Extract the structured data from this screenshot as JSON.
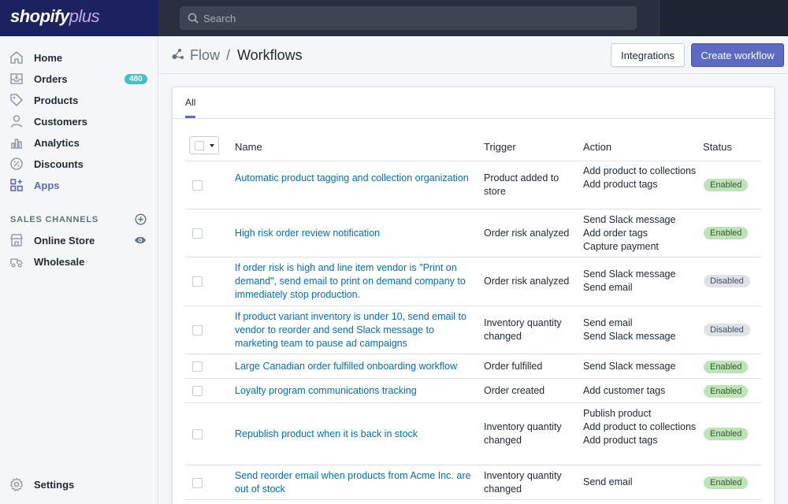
{
  "brand": {
    "name": "shopify",
    "suffix": "plus"
  },
  "search": {
    "placeholder": "Search"
  },
  "sidebar": {
    "items": [
      {
        "label": "Home",
        "icon": "home-icon"
      },
      {
        "label": "Orders",
        "icon": "orders-icon",
        "badge": "480"
      },
      {
        "label": "Products",
        "icon": "tag-icon"
      },
      {
        "label": "Customers",
        "icon": "person-icon"
      },
      {
        "label": "Analytics",
        "icon": "bar-chart-icon"
      },
      {
        "label": "Discounts",
        "icon": "discount-icon"
      },
      {
        "label": "Apps",
        "icon": "apps-icon",
        "active": true
      }
    ],
    "sales_channels_header": "SALES CHANNELS",
    "channels": [
      {
        "label": "Online Store",
        "icon": "store-icon"
      },
      {
        "label": "Wholesale",
        "icon": "wholesale-icon"
      }
    ],
    "settings": {
      "label": "Settings",
      "icon": "gear-icon"
    }
  },
  "header": {
    "breadcrumb_app": "Flow",
    "separator": "/",
    "title": "Workflows",
    "integrations_label": "Integrations",
    "create_label": "Create workflow"
  },
  "tabs": {
    "all": "All"
  },
  "table": {
    "columns": [
      "Name",
      "Trigger",
      "Action",
      "Status"
    ],
    "rows": [
      {
        "name": "Automatic product tagging and collection organization",
        "trigger": "Product added to store",
        "actions": [
          "Add product to collections",
          "Add product tags"
        ],
        "status": "Enabled"
      },
      {
        "name": "High risk order review notification",
        "trigger": "Order risk analyzed",
        "actions": [
          "Send Slack message",
          "Add order tags",
          "Capture payment"
        ],
        "status": "Enabled"
      },
      {
        "name": "If order risk is high and line item vendor is \"Print on demand\", send email to print on demand company to immediately stop production.",
        "trigger": "Order risk analyzed",
        "actions": [
          "Send Slack message",
          "Send email"
        ],
        "status": "Disabled"
      },
      {
        "name": "If product variant inventory is under 10, send email to vendor to reorder and send Slack message to marketing team to pause ad campaigns",
        "trigger": "Inventory quantity changed",
        "actions": [
          "Send email",
          "Send Slack message"
        ],
        "status": "Disabled"
      },
      {
        "name": "Large Canadian order fulfilled onboarding workflow",
        "trigger": "Order fulfilled",
        "actions": [
          "Send Slack message"
        ],
        "status": "Enabled"
      },
      {
        "name": "Loyalty program communications tracking",
        "trigger": "Order created",
        "actions": [
          "Add customer tags"
        ],
        "status": "Enabled"
      },
      {
        "name": "Republish product when it is back in stock",
        "trigger": "Inventory quantity changed",
        "actions": [
          "Publish product",
          "Add product to collections",
          "Add product tags"
        ],
        "status": "Enabled"
      },
      {
        "name": "Send reorder email when products from Acme Inc. are out of stock",
        "trigger": "Inventory quantity changed",
        "actions": [
          "Send email"
        ],
        "status": "Enabled"
      }
    ]
  },
  "colors": {
    "accent": "#5c6ac4",
    "link": "#006fbb",
    "enabled": "#bbe5b3",
    "disabled": "#dfe3e8",
    "badge": "#47c1bf"
  }
}
